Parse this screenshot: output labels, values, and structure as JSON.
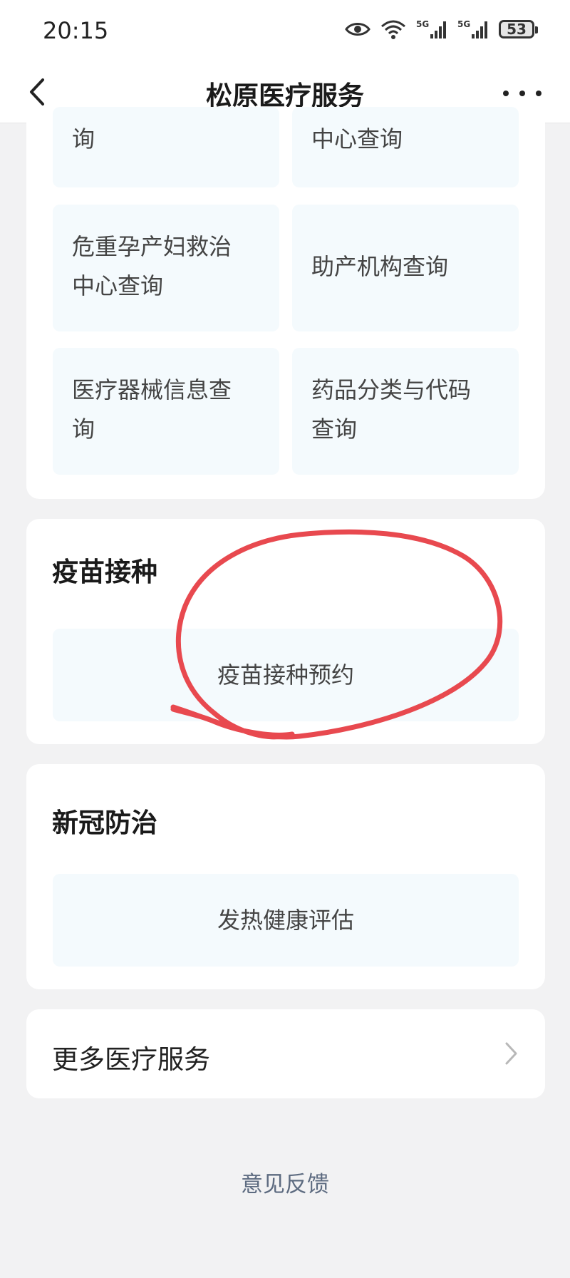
{
  "status_bar": {
    "time": "20:15",
    "battery": "53",
    "icons": [
      "eye-icon",
      "wifi-icon",
      "signal-5g-icon",
      "signal-5g-icon",
      "battery-icon"
    ]
  },
  "nav": {
    "title": "松原医疗服务",
    "back_icon": "chevron-left-icon",
    "more_icon": "more-dots-icon"
  },
  "query_section": {
    "tiles": [
      {
        "label": "询"
      },
      {
        "label": "中心查询"
      },
      {
        "label": "危重孕产妇救治\n中心查询"
      },
      {
        "label": "助产机构查询"
      },
      {
        "label": "医疗器械信息查\n询"
      },
      {
        "label": "药品分类与代码\n查询"
      }
    ]
  },
  "vaccine_section": {
    "title": "疫苗接种",
    "button": "疫苗接种预约",
    "annotation": "red-hand-drawn-circle"
  },
  "covid_section": {
    "title": "新冠防治",
    "button": "发热健康评估"
  },
  "more_services": {
    "label": "更多医疗服务",
    "icon": "chevron-right-icon"
  },
  "feedback": {
    "label": "意见反馈"
  },
  "colors": {
    "tile_bg": "#f4fafd",
    "page_bg": "#f2f2f3",
    "annotation": "#e8494f",
    "feedback_text": "#5d6b80"
  }
}
